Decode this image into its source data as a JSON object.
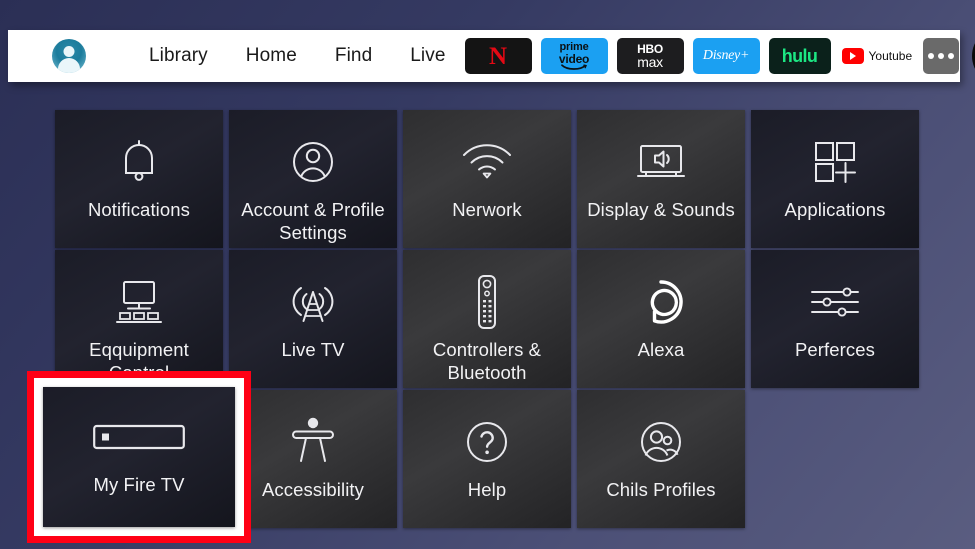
{
  "theme": {
    "bg_gradient_from": "#2b2f55",
    "bg_gradient_to": "#5a5d80",
    "topbar_bg": "#ffffff",
    "tile_bg_dark": "#1b1c27",
    "tile_bg_gray": "#2e2e30",
    "highlight_color": "#ff0015",
    "label_color": "#f2f2f4"
  },
  "topbar": {
    "avatar_name": "profile-avatar",
    "nav_links": [
      {
        "label": "Library",
        "name": "nav-library"
      },
      {
        "label": "Home",
        "name": "nav-home"
      },
      {
        "label": "Find",
        "name": "nav-find"
      },
      {
        "label": "Live",
        "name": "nav-live"
      }
    ],
    "apps": [
      {
        "name": "netflix",
        "mark": "N",
        "bg": "#141414",
        "fg": "#e50914"
      },
      {
        "name": "prime-video",
        "line1": "prime",
        "line2": "video",
        "bg": "#1ba0f2",
        "fg": "#0b1114"
      },
      {
        "name": "hbo-max",
        "line1": "HBO",
        "line2": "max",
        "bg": "#1d1d1f",
        "fg": "#ffffff"
      },
      {
        "name": "disney-plus",
        "mark": "Disney+",
        "bg": "#1ba0f2",
        "fg": "#ffffff"
      },
      {
        "name": "hulu",
        "mark": "hulu",
        "bg": "#0b211b",
        "fg": "#1ce783"
      },
      {
        "name": "youtube",
        "mark": "Youtube",
        "bg": "#ffffff",
        "fg": "#111111"
      }
    ],
    "more_label": "more-apps",
    "settings_label": "settings-gear"
  },
  "grid": {
    "rows": [
      [
        {
          "label": "Notifications",
          "icon": "bell-icon",
          "style": "dark"
        },
        {
          "label": "Account & Profile Settings",
          "icon": "person-circle-icon",
          "style": "dark"
        },
        {
          "label": "Nerwork",
          "icon": "wifi-icon",
          "style": "gray"
        },
        {
          "label": "Display & Sounds",
          "icon": "tv-speaker-icon",
          "style": "gray"
        },
        {
          "label": "Applications",
          "icon": "app-grid-plus-icon",
          "style": "dark"
        }
      ],
      [
        {
          "label": "Eqquipment Control",
          "icon": "monitor-keyboard-icon",
          "style": "dark"
        },
        {
          "label": "Live TV",
          "icon": "antenna-icon",
          "style": "dark"
        },
        {
          "label": "Controllers & Bluetooth",
          "icon": "remote-control-icon",
          "style": "gray"
        },
        {
          "label": "Alexa",
          "icon": "alexa-ring-icon",
          "style": "gray"
        },
        {
          "label": "Perferces",
          "icon": "sliders-icon",
          "style": "dark"
        }
      ],
      [
        {
          "label": "My Fire TV",
          "icon": "fire-tv-stick-icon",
          "style": "dark",
          "highlighted": true
        },
        {
          "label": "Accessibility",
          "icon": "accessibility-icon",
          "style": "gray"
        },
        {
          "label": "Help",
          "icon": "question-circle-icon",
          "style": "gray"
        },
        {
          "label": "Chils Profiles",
          "icon": "people-circle-icon",
          "style": "gray"
        }
      ]
    ]
  }
}
